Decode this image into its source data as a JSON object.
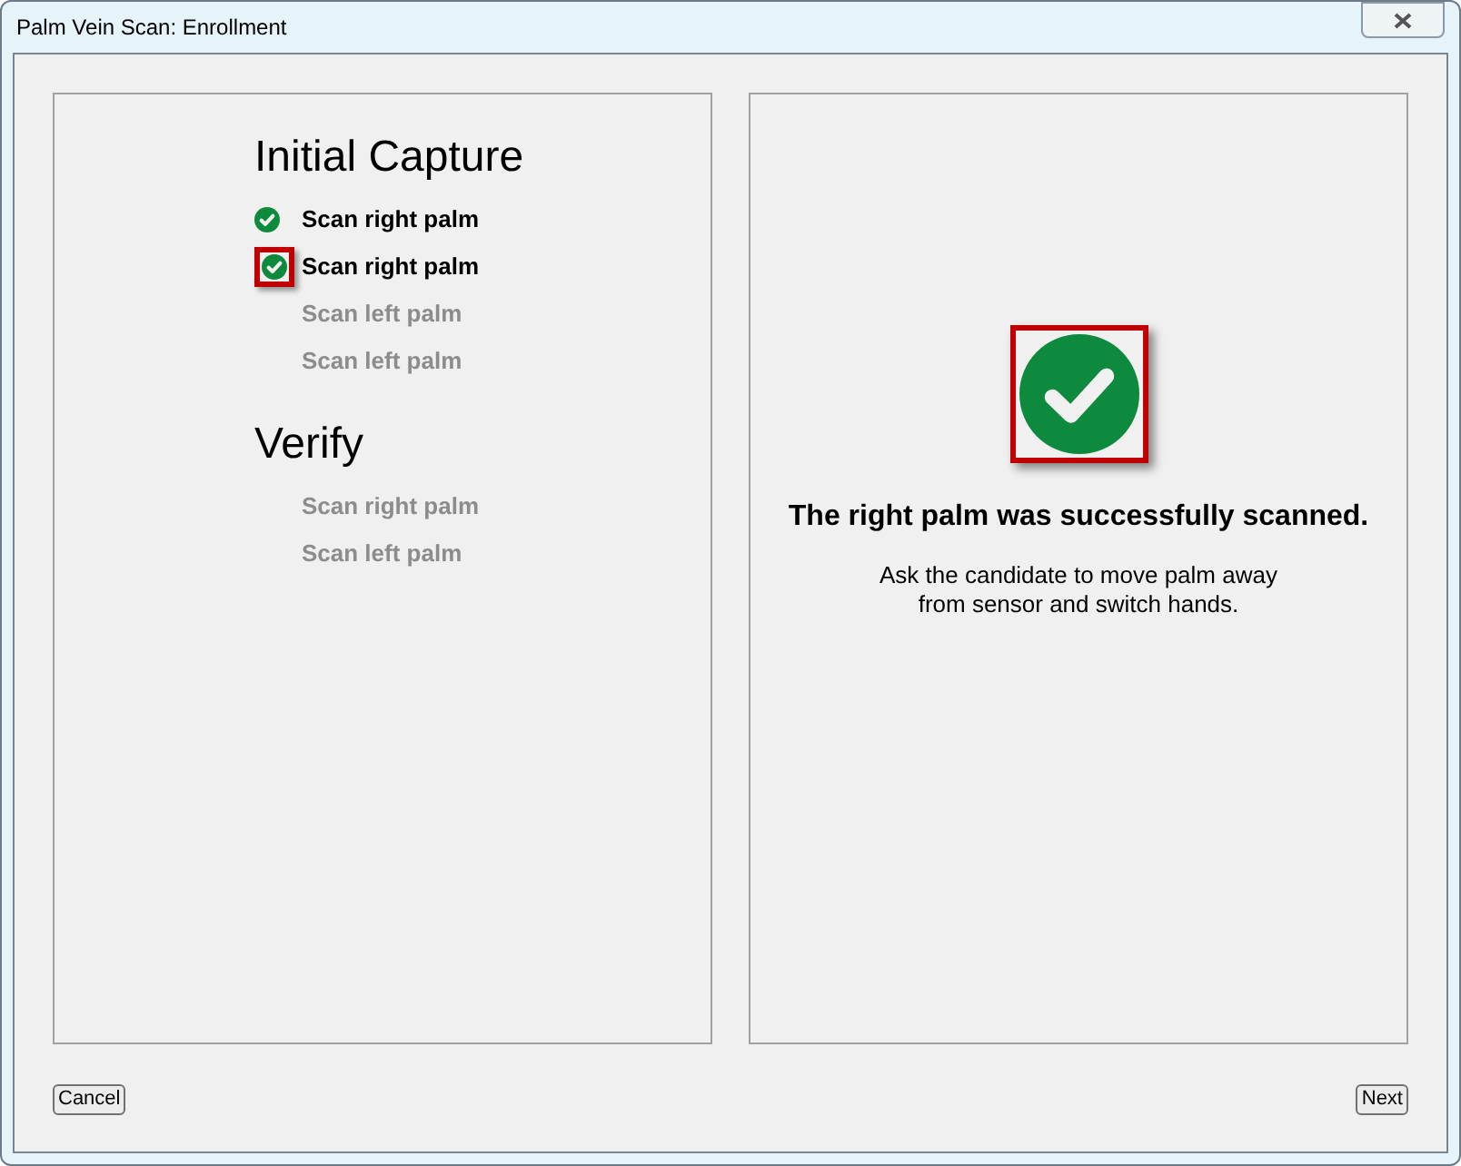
{
  "window": {
    "title": "Palm Vein Scan: Enrollment"
  },
  "sections": [
    {
      "title": "Initial Capture",
      "steps": [
        {
          "label": "Scan right palm",
          "done": true,
          "highlighted": false
        },
        {
          "label": "Scan right palm",
          "done": true,
          "highlighted": true
        },
        {
          "label": "Scan left palm",
          "done": false,
          "highlighted": false
        },
        {
          "label": "Scan left palm",
          "done": false,
          "highlighted": false
        }
      ]
    },
    {
      "title": "Verify",
      "steps": [
        {
          "label": "Scan right palm",
          "done": false,
          "highlighted": false
        },
        {
          "label": "Scan left palm",
          "done": false,
          "highlighted": false
        }
      ]
    }
  ],
  "result": {
    "success": true,
    "highlighted": true,
    "heading": "The right palm was successfully scanned.",
    "message_lines": [
      "Ask the candidate to move palm away",
      "from sensor and switch hands."
    ]
  },
  "buttons": {
    "cancel": "Cancel",
    "next": "Next"
  }
}
